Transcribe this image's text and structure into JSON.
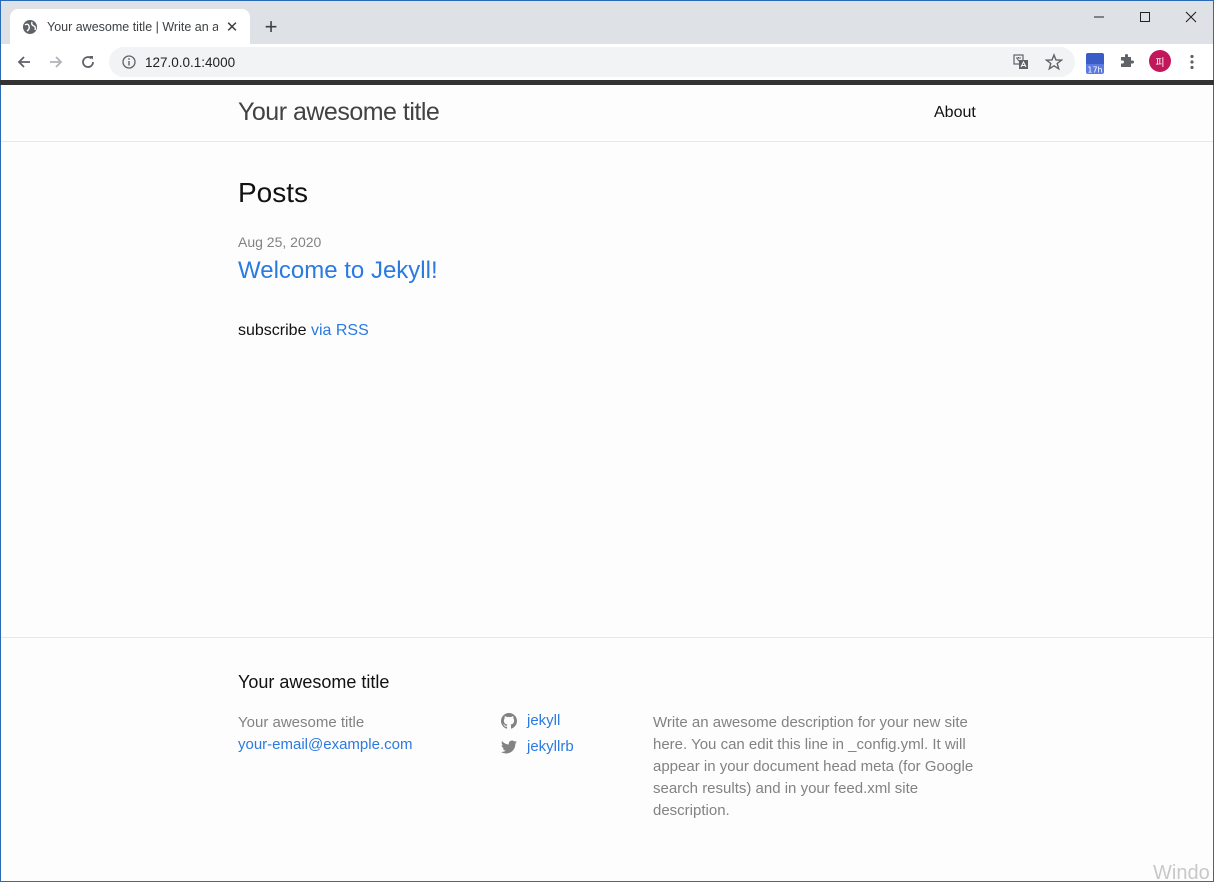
{
  "browser": {
    "tab_title": "Your awesome title | Write an a",
    "tab_close": "✕",
    "new_tab": "+",
    "url": "127.0.0.1:4000",
    "avatar_initial": "피",
    "extension_badge": "17h"
  },
  "header": {
    "site_title": "Your awesome title",
    "nav_about": "About"
  },
  "main": {
    "heading": "Posts",
    "posts": [
      {
        "date": "Aug 25, 2020",
        "title": "Welcome to Jekyll!"
      }
    ],
    "subscribe_text": "subscribe",
    "subscribe_link": "via RSS"
  },
  "footer": {
    "heading": "Your awesome title",
    "name": "Your awesome title",
    "email": "your-email@example.com",
    "github": "jekyll",
    "twitter": "jekyllrb",
    "description": "Write an awesome description for your new site here. You can edit this line in _config.yml. It will appear in your document head meta (for Google search results) and in your feed.xml site description."
  },
  "os": {
    "watermark": "Windo"
  },
  "colors": {
    "link": "#2a7ae2",
    "meta": "#828282",
    "avatar": "#c2185b"
  }
}
